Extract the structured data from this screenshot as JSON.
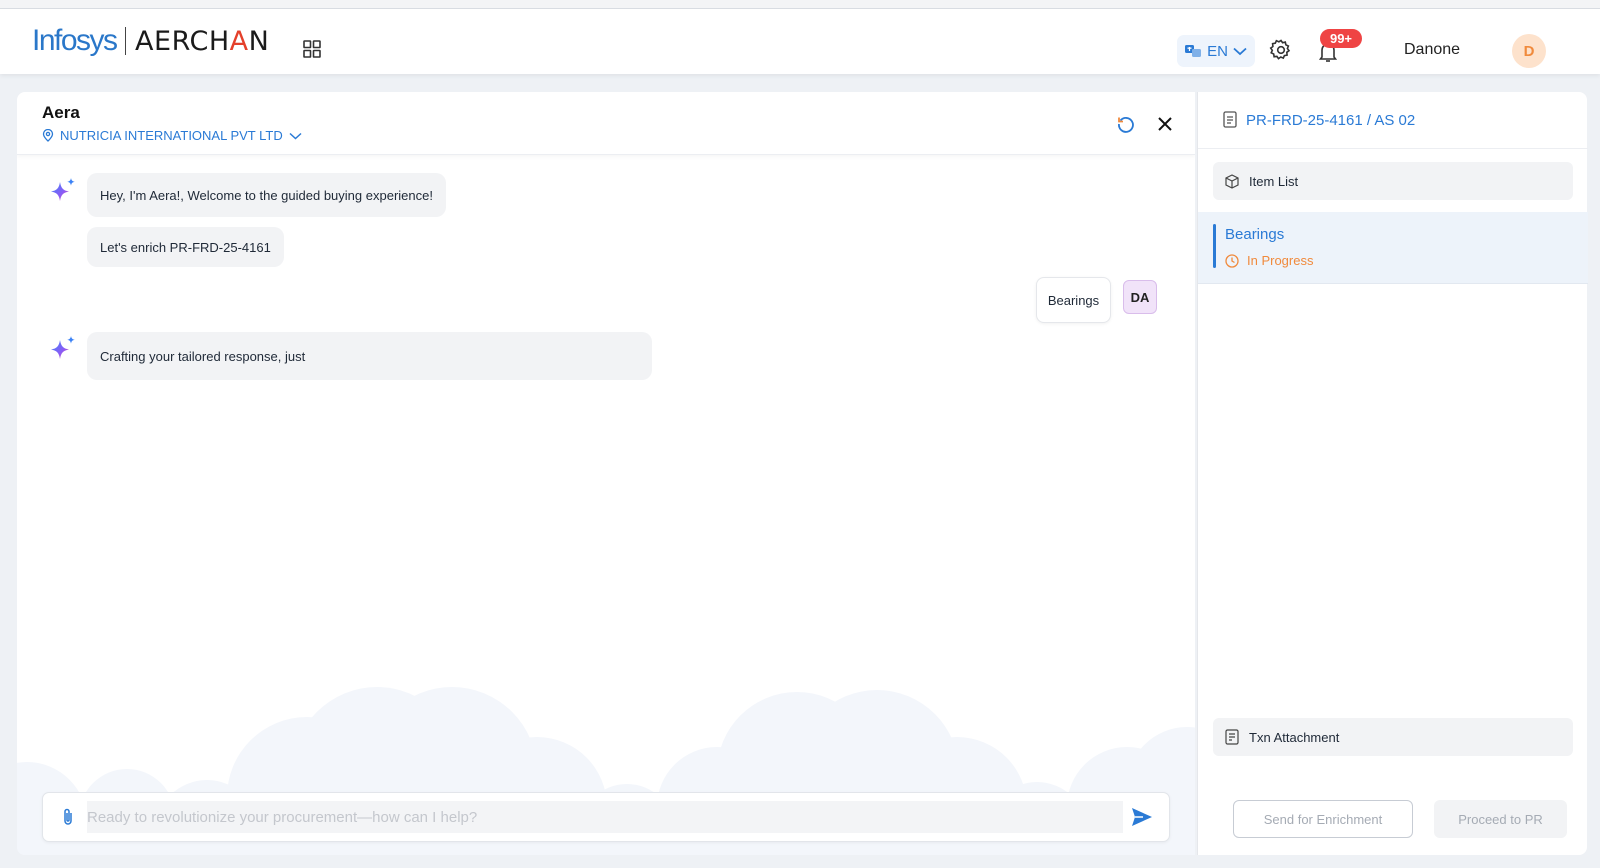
{
  "header": {
    "logo_primary": "Infosys",
    "logo_secondary_parts": [
      "AERCH",
      "A",
      "N"
    ],
    "apps_icon": "grid-icon",
    "language": "EN",
    "notifications_count": "99+",
    "user_name": "Danone",
    "avatar_initial": "D",
    "colors": {
      "brand_blue": "#2a77c9",
      "accent_red": "#e4402b",
      "badge": "#ef4444"
    }
  },
  "chat": {
    "title": "Aera",
    "organization": "NUTRICIA INTERNATIONAL PVT LTD",
    "messages": [
      {
        "from": "bot",
        "text": "Hey, I'm Aera!, Welcome to the guided buying experience!"
      },
      {
        "from": "bot",
        "text": "Let's enrich PR-FRD-25-4161"
      },
      {
        "from": "user",
        "text": "Bearings",
        "initials": "DA"
      },
      {
        "from": "bot",
        "text": "Crafting your tailored response, just"
      }
    ],
    "input_placeholder": "Ready to revolutionize your procurement—how can I help?"
  },
  "side": {
    "pr_number": "PR-FRD-25-4161 / AS 02",
    "item_list_label": "Item List",
    "selected_item": {
      "name": "Bearings",
      "status": "In Progress"
    },
    "txn_attachment_label": "Txn Attachment",
    "send_enrichment_label": "Send for Enrichment",
    "proceed_label": "Proceed to PR"
  }
}
